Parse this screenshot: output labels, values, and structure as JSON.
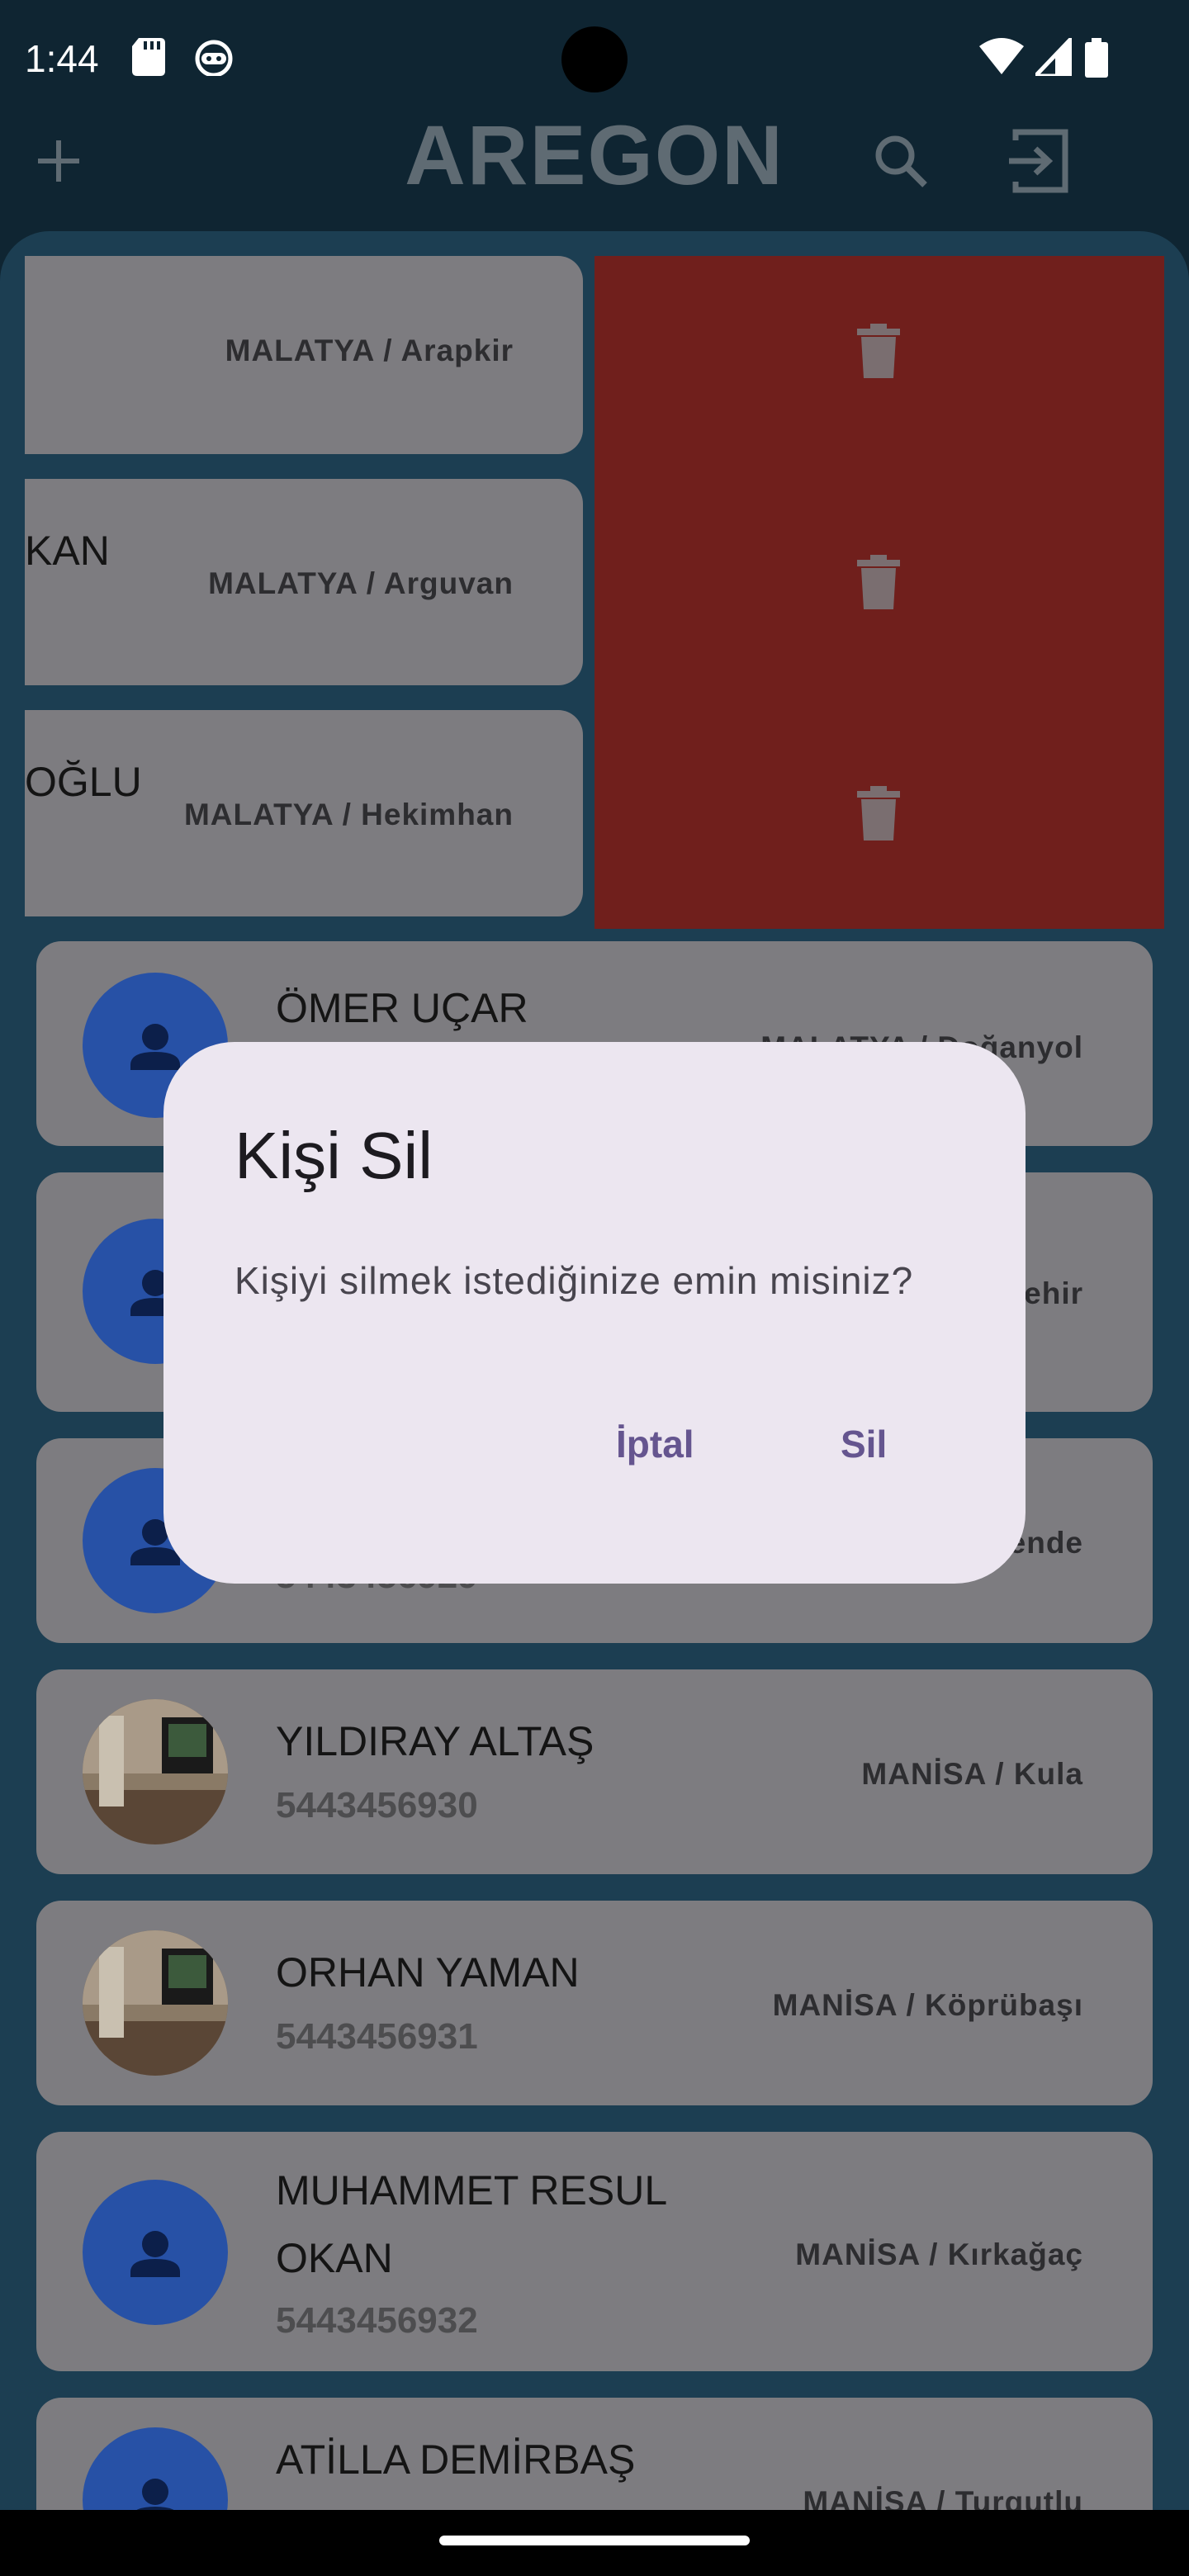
{
  "status_bar": {
    "time": "1:44"
  },
  "app_bar": {
    "title": "AREGON"
  },
  "swiped_items": [
    {
      "name": "",
      "location": "MALATYA / Arapkir"
    },
    {
      "name": "KAN",
      "location": "MALATYA / Arguvan"
    },
    {
      "name": "OĞLU",
      "location": "MALATYA / Hekimhan"
    }
  ],
  "contacts": [
    {
      "name": "ÖMER UÇAR",
      "phone": "",
      "location": "MALATYA / Doğanyol"
    },
    {
      "name": "",
      "phone": "",
      "location": "ehir"
    },
    {
      "name": "",
      "phone": "5443456929",
      "location": "ende"
    },
    {
      "name": "YILDIRAY ALTAŞ",
      "phone": "5443456930",
      "location": "MANİSA / Kula"
    },
    {
      "name": "ORHAN YAMAN",
      "phone": "5443456931",
      "location": "MANİSA / Köprübaşı"
    },
    {
      "name_line1": "MUHAMMET RESUL",
      "name_line2": "OKAN",
      "phone": "5443456932",
      "location": "MANİSA / Kırkağaç"
    },
    {
      "name": "ATİLLA DEMİRBAŞ",
      "phone": "",
      "location": "MANİSA / Turgutlu"
    }
  ],
  "dialog": {
    "title": "Kişi Sil",
    "message": "Kişiyi silmek istediğinize emin misiniz?",
    "cancel_label": "İptal",
    "confirm_label": "Sil"
  },
  "colors": {
    "scrim_bg": "#0f2532",
    "card": "#7d7c80",
    "delete": "#701f1c",
    "avatar": "#2751a6",
    "dialog_bg": "#ece6f0",
    "dialog_button": "#65558f"
  }
}
